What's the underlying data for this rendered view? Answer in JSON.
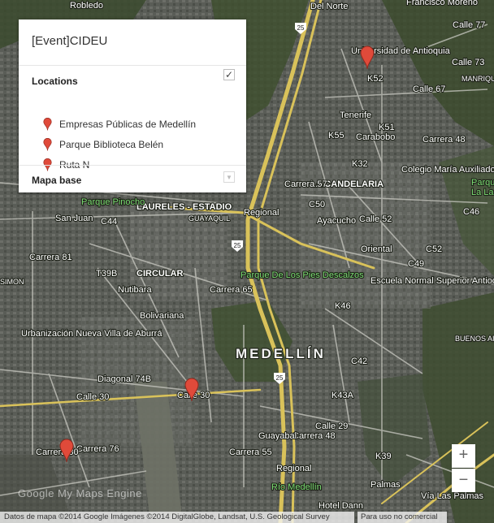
{
  "panel": {
    "title": "[Event]CIDEU",
    "locations_heading": "Locations",
    "locations": [
      {
        "label": "Empresas Públicas de Medellín"
      },
      {
        "label": "Parque Biblioteca Belén"
      },
      {
        "label": "Ruta N"
      }
    ],
    "base_heading": "Mapa base",
    "layer_checked": true
  },
  "map": {
    "city_label": "MEDELLÍN",
    "labels": {
      "robledo": "Robledo",
      "del_norte": "Del Norte",
      "francisco": "Francisco Moreno",
      "calle77": "Calle 77",
      "calle73": "Calle 73",
      "calle67": "Calle 67",
      "udea": "Universidad de Antioquia",
      "manrique": "MANRIQUE",
      "la_candelaria": "LA CANDELARIA",
      "laureles": "LAURELES - ESTADIO",
      "pinocho": "Parque Pinocho",
      "san_juan": "San Juan",
      "c44": "C44",
      "guayaquil": "GUAYAQUIL",
      "ayacucho": "Ayacucho",
      "circular": "CIRCULAR",
      "nutibara": "Nutibara",
      "bolivariana": "Bolivariana",
      "pies_descalzos": "Parque De Los Pies Descalzos",
      "escuela_normal": "Escuela Normal Superior Antioquia",
      "colegio_maria": "Colegio María Auxiliadora",
      "urbanizacion": "Urbanización Nueva Villa de Aburrá",
      "diagonal74b": "Diagonal 74B",
      "calle30": "Calle 30",
      "calle30b": "Calle 30",
      "calle29": "Calle 29",
      "carrera65": "Carrera 65",
      "carrera55": "Carrera 55",
      "carrera48": "Carrera 48",
      "carrera76": "Carrera 76",
      "carrera80": "Carrera 80",
      "carrera81": "Carrera 81",
      "carrera57": "Carrera 57",
      "carrera48b": "Carrera 48",
      "regional": "Regional",
      "regional2": "Regional",
      "guayabal": "Guayabal",
      "rio_medellin": "Río Medellín",
      "hotel_dann": "Hotel Dann",
      "via_palmas": "Vía Las Palmas",
      "buenos_aires": "BUENOS AIRES",
      "c50": "C50",
      "c49": "C49",
      "c52": "C52",
      "calle52": "Calle 52",
      "c46": "C46",
      "c42": "C42",
      "k43a": "K43A",
      "k46": "K46",
      "k55": "K55",
      "k52": "K52",
      "k51": "K51",
      "k32": "K32",
      "tenerife": "Tenerife",
      "carabobo": "Carabobo",
      "oriental": "Oriental",
      "t39b": "T39B",
      "k39": "K39",
      "road25": "25",
      "simon": "SIMON",
      "palmas": "Palmas",
      "la_ladera": "La Lad",
      "parque_pr": "Parque"
    }
  },
  "controls": {
    "zoom_in": "+",
    "zoom_out": "−"
  },
  "footer": {
    "attribution": "Datos de mapa ©2014 Google Imágenes ©2014 DigitalGlobe, Landsat, U.S. Geological Survey",
    "terms": "Para uso no comercial",
    "logo": "Google My Maps Engine"
  },
  "colors": {
    "marker": "#e04a3a",
    "road_yellow": "#d9c25a"
  }
}
